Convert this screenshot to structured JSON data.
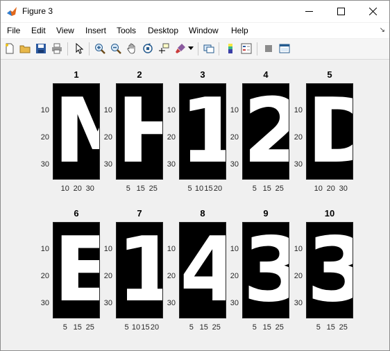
{
  "window": {
    "title": "Figure 3"
  },
  "menu": [
    "File",
    "Edit",
    "View",
    "Insert",
    "Tools",
    "Desktop",
    "Window",
    "Help"
  ],
  "toolbar": [
    "new-figure-icon",
    "open-file-icon",
    "save-icon",
    "print-icon",
    "select-arrow-icon",
    "zoom-in-icon",
    "zoom-out-icon",
    "pan-hand-icon",
    "rotate-3d-icon",
    "data-cursor-icon",
    "brush-icon",
    "link-plot-icon",
    "colorbar-icon",
    "legend-icon",
    "hide-plot-tools-icon",
    "show-plot-tools-icon"
  ],
  "subplots": [
    {
      "title": "1",
      "glyph": "M",
      "yticks": [
        "10",
        "20",
        "30"
      ],
      "xticks": [
        "10",
        "20",
        "30"
      ]
    },
    {
      "title": "2",
      "glyph": "H",
      "yticks": [
        "10",
        "20",
        "30"
      ],
      "xticks": [
        "5",
        "15",
        "25"
      ]
    },
    {
      "title": "3",
      "glyph": "1",
      "yticks": [
        "10",
        "20",
        "30"
      ],
      "xticks": [
        "5",
        "10",
        "15",
        "20"
      ]
    },
    {
      "title": "4",
      "glyph": "2",
      "yticks": [
        "10",
        "20",
        "30"
      ],
      "xticks": [
        "5",
        "15",
        "25"
      ]
    },
    {
      "title": "5",
      "glyph": "D",
      "yticks": [
        "10",
        "20",
        "30"
      ],
      "xticks": [
        "10",
        "20",
        "30"
      ]
    },
    {
      "title": "6",
      "glyph": "E",
      "yticks": [
        "10",
        "20",
        "30"
      ],
      "xticks": [
        "5",
        "15",
        "25"
      ]
    },
    {
      "title": "7",
      "glyph": "1",
      "yticks": [
        "10",
        "20",
        "30"
      ],
      "xticks": [
        "5",
        "10",
        "15",
        "20"
      ]
    },
    {
      "title": "8",
      "glyph": "4",
      "yticks": [
        "10",
        "20",
        "30"
      ],
      "xticks": [
        "5",
        "15",
        "25"
      ]
    },
    {
      "title": "9",
      "glyph": "3",
      "yticks": [
        "10",
        "20",
        "30"
      ],
      "xticks": [
        "5",
        "15",
        "25"
      ]
    },
    {
      "title": "10",
      "glyph": "3",
      "yticks": [
        "10",
        "20",
        "30"
      ],
      "xticks": [
        "5",
        "15",
        "25"
      ]
    }
  ]
}
